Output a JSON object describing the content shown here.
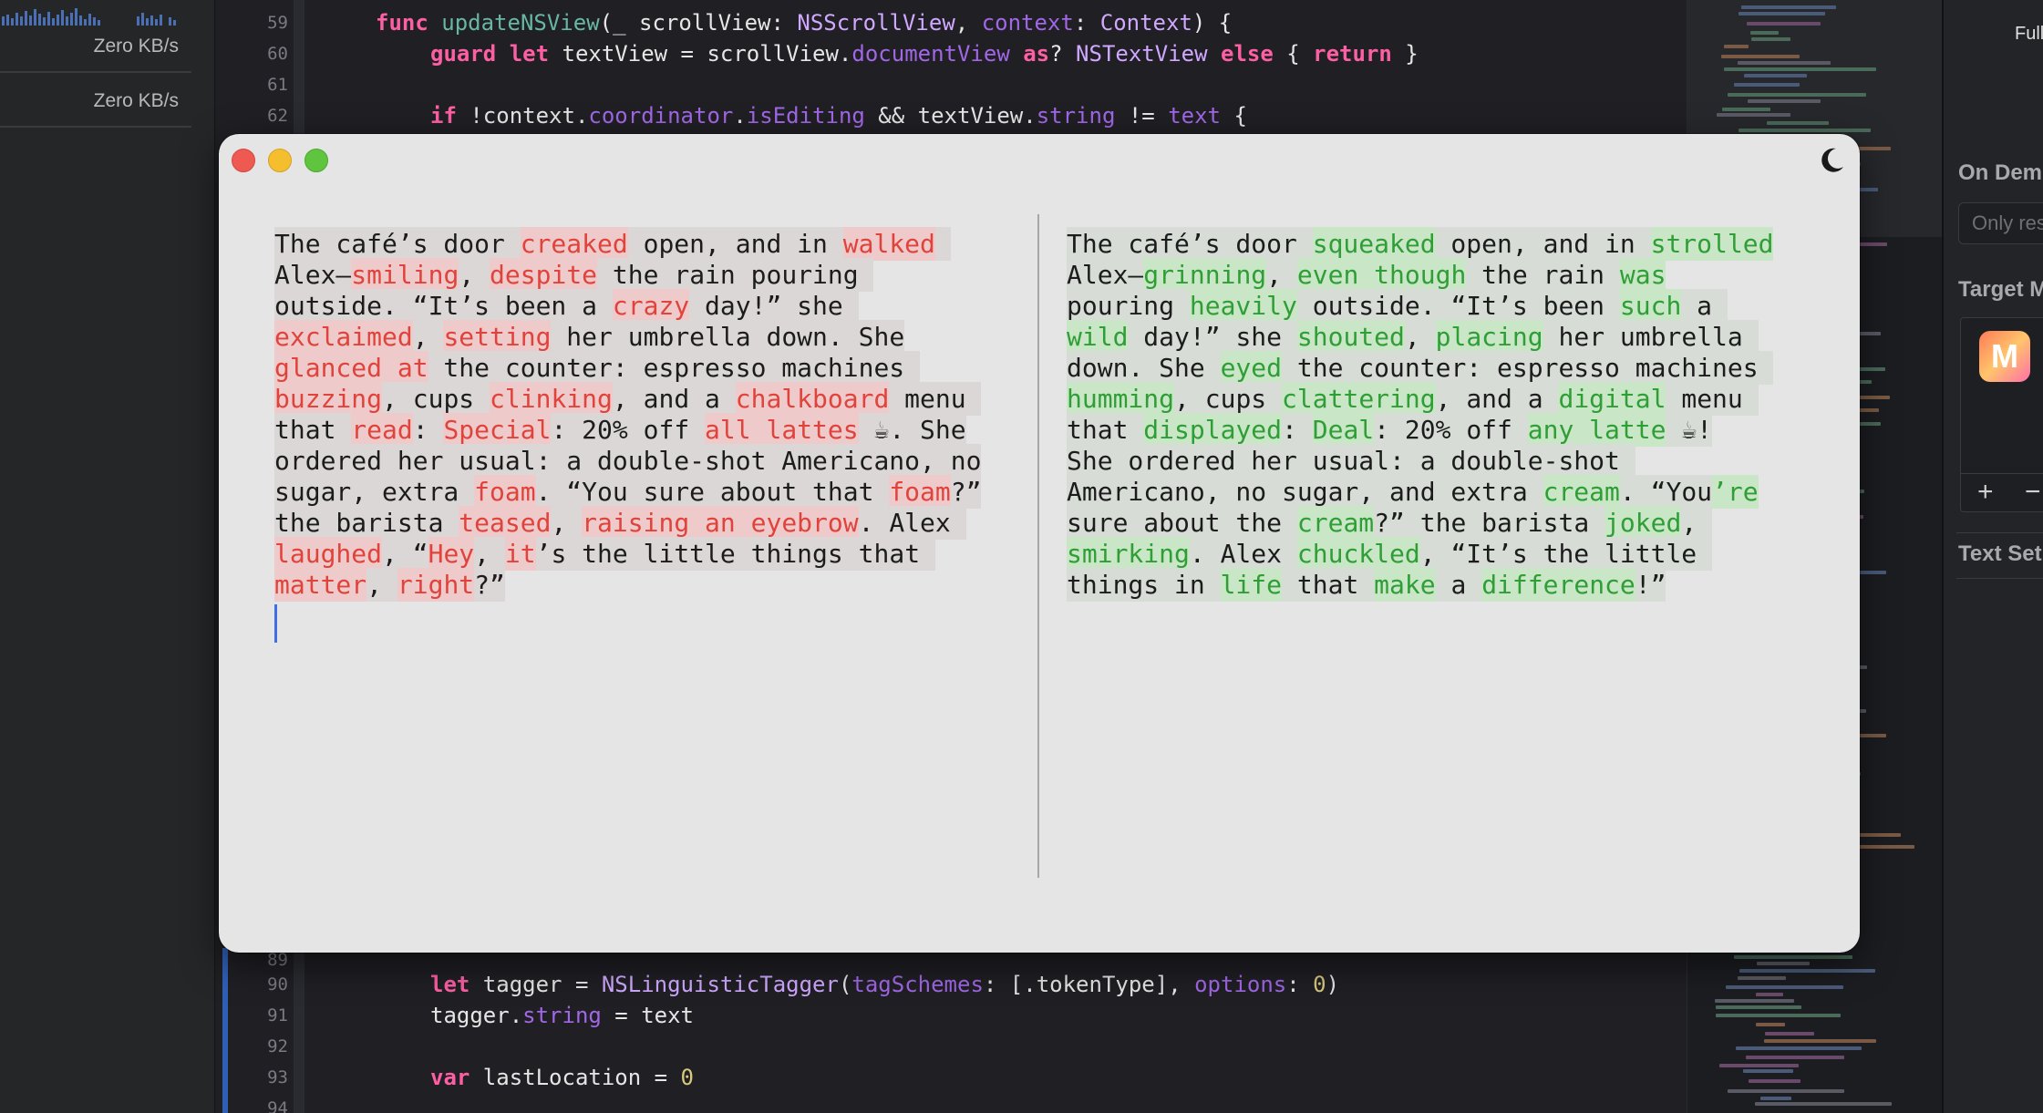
{
  "network_panel": {
    "rows": [
      {
        "label": "Zero KB/s"
      },
      {
        "label": "Zero KB/s"
      }
    ]
  },
  "editor": {
    "lines_top": [
      {
        "num": "59",
        "text": "func updateNSView(_ scrollView: NSScrollView, context: Context) {"
      },
      {
        "num": "60",
        "text": "guard let textView = scrollView.documentView as? NSTextView else { return }"
      },
      {
        "num": "61",
        "text": ""
      },
      {
        "num": "62",
        "text": "if !context.coordinator.isEditing && textView.string != text {"
      }
    ],
    "lines_bottom": [
      {
        "num": "89",
        "text": ""
      },
      {
        "num": "90",
        "text": "let tagger = NSLinguisticTagger(tagSchemes: [.tokenType], options: 0)"
      },
      {
        "num": "91",
        "text": "tagger.string = text"
      },
      {
        "num": "92",
        "text": ""
      },
      {
        "num": "93",
        "text": "var lastLocation = 0"
      },
      {
        "num": "94",
        "text": ""
      }
    ]
  },
  "inspector": {
    "top_label": "Full",
    "on_demand_label": "On Dem",
    "on_demand_placeholder": "Only res",
    "target_label": "Target M",
    "add_label": "+",
    "remove_label": "−",
    "text_settings_label": "Text Set",
    "app_icon_letter": "M"
  },
  "diff_window": {
    "theme_toggle_icon": "moon-icon",
    "colors": {
      "deleted_text": "#e0433b",
      "deleted_bg": "#eecaca",
      "inserted_text": "#2f9e36",
      "inserted_bg": "#c9e6c6"
    },
    "original": {
      "lines": [
        [
          "The café’s door ",
          {
            "d": "creaked"
          },
          " open, and in ",
          {
            "d": "walked"
          },
          " "
        ],
        [
          "Alex—",
          {
            "d": "smiling"
          },
          ", ",
          {
            "d": "despite"
          },
          " the rain pouring "
        ],
        [
          "outside. “It’s been a ",
          {
            "d": "crazy"
          },
          " day!” she "
        ],
        [
          {
            "d": "exclaimed"
          },
          ", ",
          {
            "d": "setting"
          },
          " her umbrella down. She"
        ],
        [
          {
            "d": "glanced at"
          },
          " the counter: espresso machines "
        ],
        [
          {
            "d": "buzzing"
          },
          ", cups ",
          {
            "d": "clinking"
          },
          ", and a ",
          {
            "d": "chalkboard"
          },
          " menu "
        ],
        [
          "that ",
          {
            "d": "read"
          },
          ": ",
          {
            "d": "Special"
          },
          ": 20% off ",
          {
            "d": "all lattes"
          },
          " ☕. She"
        ],
        [
          "ordered her usual: a double-shot Americano, no"
        ],
        [
          "sugar, extra ",
          {
            "d": "foam"
          },
          ". “You sure about that ",
          {
            "d": "foam"
          },
          "?”"
        ],
        [
          "the barista ",
          {
            "d": "teased"
          },
          ", ",
          {
            "d": "raising an eyebrow"
          },
          ". Alex "
        ],
        [
          {
            "d": "laughed"
          },
          ", “",
          {
            "d": "Hey"
          },
          ", ",
          {
            "d": "it"
          },
          "’s the little things that "
        ],
        [
          {
            "d": "matter"
          },
          ", ",
          {
            "d": "right"
          },
          "?”"
        ]
      ]
    },
    "revised": {
      "lines": [
        [
          "The café’s door ",
          {
            "i": "squeaked"
          },
          " open, and in ",
          {
            "i": "strolled"
          }
        ],
        [
          "Alex—",
          {
            "i": "grinning"
          },
          ", ",
          {
            "i": "even though"
          },
          " the rain ",
          {
            "i": "was"
          }
        ],
        [
          "pouring ",
          {
            "i": "heavily"
          },
          " outside. “It’s been ",
          {
            "i": "such"
          },
          " a "
        ],
        [
          {
            "i": "wild"
          },
          " day!” she ",
          {
            "i": "shouted"
          },
          ", ",
          {
            "i": "placing"
          },
          " her umbrella "
        ],
        [
          "down. She ",
          {
            "i": "eyed"
          },
          " the counter: espresso machines "
        ],
        [
          {
            "i": "humming"
          },
          ", cups ",
          {
            "i": "clattering"
          },
          ", and a ",
          {
            "i": "digital"
          },
          " menu "
        ],
        [
          "that ",
          {
            "i": "displayed"
          },
          ": ",
          {
            "i": "Deal"
          },
          ": 20% off ",
          {
            "i": "any latte"
          },
          " ☕!"
        ],
        [
          "She ordered her usual: a double-shot "
        ],
        [
          "Americano, no sugar, and extra ",
          {
            "i": "cream"
          },
          ". “You",
          {
            "i": "’re"
          }
        ],
        [
          "sure about the ",
          {
            "i": "cream"
          },
          "?” the barista ",
          {
            "i": "joked"
          },
          ", "
        ],
        [
          {
            "i": "smirking"
          },
          ". Alex ",
          {
            "i": "chuckled"
          },
          ", “It’s the little "
        ],
        [
          "things in ",
          {
            "i": "life"
          },
          " that ",
          {
            "i": "make"
          },
          " a ",
          {
            "i": "difference"
          },
          "!”"
        ]
      ]
    }
  }
}
